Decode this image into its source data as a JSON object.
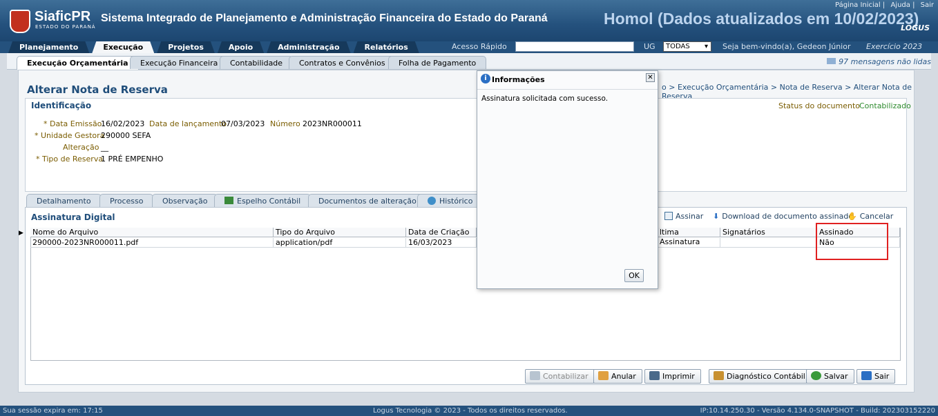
{
  "header": {
    "logo_text": "SiaficPR",
    "logo_sub": "ESTADO DO PARANÁ",
    "system_title": "Sistema Integrado de Planejamento e Administração Financeira do Estado do Paraná",
    "environment": "Homol (Dados atualizados em 10/02/2023)",
    "links": [
      "Página Inicial",
      "Ajuda",
      "Sair"
    ],
    "vendor": "LOGUS"
  },
  "main_nav": [
    "Planejamento",
    "Execução",
    "Projetos",
    "Apoio",
    "Administração",
    "Relatórios"
  ],
  "main_nav_active": "Execução",
  "quick_access": {
    "label": "Acesso Rápido",
    "value": ""
  },
  "ug": {
    "label": "UG",
    "selected": "TODAS"
  },
  "welcome": "Seja bem-vindo(a), Gedeon Júnior",
  "exercicio": "Exercício 2023",
  "sub_nav": [
    "Execução Orçamentária",
    "Execução Financeira",
    "Contabilidade",
    "Contratos e Convênios",
    "Folha de Pagamento"
  ],
  "messages": "97 mensagens não lidas",
  "page": {
    "title": "Alterar Nota de Reserva",
    "breadcrumb": "o > Execução Orçamentária > Nota de Reserva > Alterar Nota de Reserva"
  },
  "identificacao": {
    "title": "Identificação",
    "status_label": "Status do documento",
    "status_value": "Contabilizado",
    "data_emissao_label": "* Data Emissão",
    "data_emissao": "16/02/2023",
    "data_lancamento_label": "Data de lançamento",
    "data_lancamento": "07/03/2023",
    "numero_label": "Número",
    "numero": "2023NR000011",
    "unidade_label": "* Unidade Gestora",
    "unidade": "290000 SEFA",
    "alteracao_label": "Alteração",
    "alteracao": "__",
    "tipo_label": "* Tipo de Reserva",
    "tipo": "1 PRÉ EMPENHO"
  },
  "detail_tabs": [
    "Detalhamento",
    "Processo",
    "Observação",
    "Espelho Contábil",
    "Documentos de alteração",
    "Histórico"
  ],
  "assinatura": {
    "title": "Assinatura Digital",
    "actions": {
      "assinar": "Assinar",
      "download": "Download de documento assinado",
      "cancelar": "Cancelar"
    },
    "columns": [
      "Nome do Arquivo",
      "Tipo do Arquivo",
      "Data de Criação",
      "ltima Assinatura",
      "Signatários",
      "Assinado"
    ],
    "rows": [
      {
        "nome": "290000-2023NR000011.pdf",
        "tipo": "application/pdf",
        "data": "16/03/2023",
        "ultima": "",
        "signatarios": "",
        "assinado": "Não"
      }
    ]
  },
  "buttons": {
    "contabilizar": "Contabilizar",
    "anular": "Anular",
    "imprimir": "Imprimir",
    "diagnostico": "Diagnóstico Contábil",
    "salvar": "Salvar",
    "sair": "Sair"
  },
  "dialog": {
    "title": "Informações",
    "message": "Assinatura solicitada com sucesso.",
    "ok": "OK"
  },
  "footer": {
    "session": "Sua sessão expira em: 17:15",
    "copyright": "Logus Tecnologia © 2023 - Todos os direitos reservados.",
    "build": "IP:10.14.250.30 - Versão 4.134.0-SNAPSHOT - Build: 202303152220"
  }
}
